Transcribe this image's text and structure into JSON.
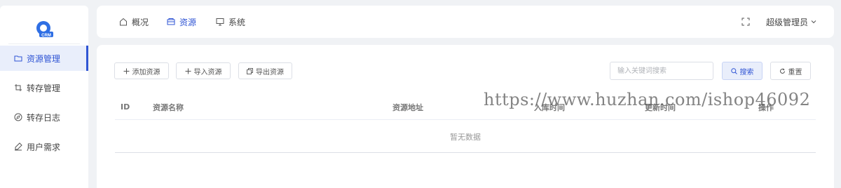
{
  "sidebar": {
    "logo_text": "CRM",
    "items": [
      {
        "label": "资源管理",
        "icon": "folder-icon",
        "active": true
      },
      {
        "label": "转存管理",
        "icon": "crop-icon",
        "active": false
      },
      {
        "label": "转存日志",
        "icon": "compass-icon",
        "active": false
      },
      {
        "label": "用户需求",
        "icon": "pen-icon",
        "active": false
      }
    ]
  },
  "topnav": {
    "tabs": [
      {
        "label": "概况",
        "icon": "home-icon",
        "active": false
      },
      {
        "label": "资源",
        "icon": "box-icon",
        "active": true
      },
      {
        "label": "系统",
        "icon": "monitor-icon",
        "active": false
      }
    ],
    "fullscreen_icon": "fullscreen-icon",
    "user_label": "超级管理员"
  },
  "toolbar": {
    "add_label": "添加资源",
    "import_label": "导入资源",
    "export_label": "导出资源",
    "search_placeholder": "输入关键词搜索",
    "search_value": "",
    "search_button": "搜索",
    "reset_button": "重置"
  },
  "table": {
    "columns": [
      "ID",
      "资源名称",
      "资源地址",
      "入库时间",
      "更新时间",
      "操作"
    ],
    "empty_text": "暂无数据"
  },
  "watermark": "https://www.huzhan.com/ishop46092",
  "colors": {
    "accent": "#2f54d4",
    "background": "#f0f2f5"
  }
}
